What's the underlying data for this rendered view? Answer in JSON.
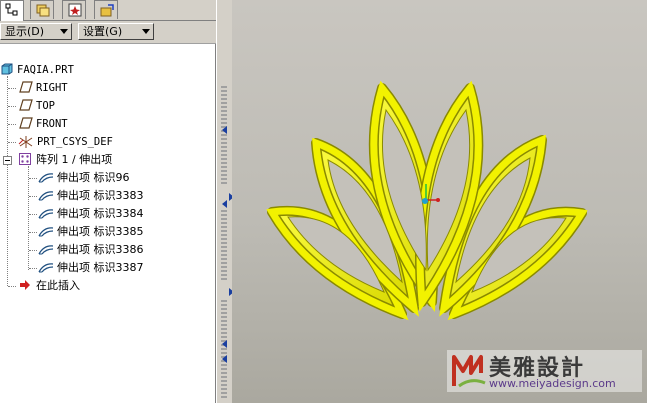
{
  "toolbar": {
    "display_label": "显示(D)",
    "settings_label": "设置(G)"
  },
  "tree": {
    "root": "FAQIA.PRT",
    "items": [
      {
        "label": "RIGHT",
        "icon": "datum-plane-icon"
      },
      {
        "label": "TOP",
        "icon": "datum-plane-icon"
      },
      {
        "label": "FRONT",
        "icon": "datum-plane-icon"
      },
      {
        "label": "PRT_CSYS_DEF",
        "icon": "csys-icon"
      }
    ],
    "pattern": "阵列 1 / 伸出项",
    "pattern_children": [
      {
        "label": "伸出项 标识96"
      },
      {
        "label": "伸出项 标识3383"
      },
      {
        "label": "伸出项 标识3384"
      },
      {
        "label": "伸出项 标识3385"
      },
      {
        "label": "伸出项 标识3386"
      },
      {
        "label": "伸出项 标识3387"
      }
    ],
    "insert_here": "在此插入"
  },
  "watermark": {
    "title": "美雅設計",
    "url": "www.meiyadesign.com"
  },
  "colors": {
    "model_fill": "#f2f200",
    "model_edge": "#8a8a00",
    "tree_bg": "#ffffff",
    "panel_bg": "#d4d0c8"
  }
}
